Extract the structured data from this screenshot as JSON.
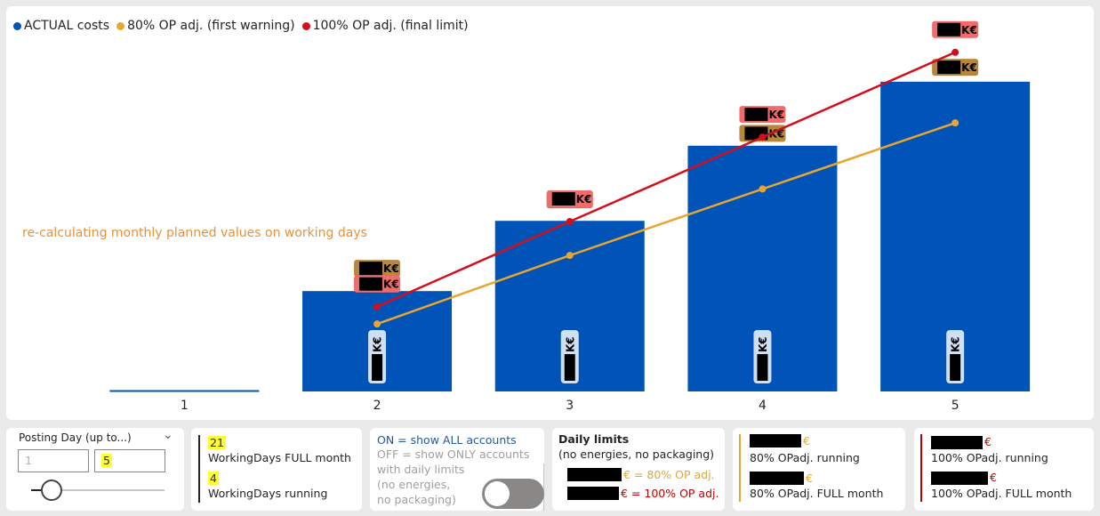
{
  "legend": [
    {
      "label": "ACTUAL costs",
      "color": "#0054b7"
    },
    {
      "label": "80% OP adj. (first warning)",
      "color": "#e8a530"
    },
    {
      "label": "100% OP adj. (final limit)",
      "color": "#d40f1b"
    }
  ],
  "annotation": "re-calculating monthly planned values on working days",
  "chart_data": {
    "type": "bar",
    "categories": [
      "1",
      "2",
      "3",
      "4",
      "5"
    ],
    "series": [
      {
        "name": "ACTUAL costs",
        "type": "bar",
        "values": [
          0,
          0.29,
          0.493,
          0.71,
          0.895
        ],
        "color": "#0054b7",
        "data_label": "K€"
      },
      {
        "name": "80% OP adj. (first warning)",
        "type": "line",
        "values": [
          null,
          0.195,
          0.393,
          0.585,
          0.776
        ],
        "color": "#e8a530",
        "data_label": "K€"
      },
      {
        "name": "100% OP adj. (final limit)",
        "type": "line",
        "values": [
          null,
          0.245,
          0.491,
          0.735,
          0.98
        ],
        "color": "#d40f1b",
        "data_label": "K€"
      }
    ],
    "ylim": [
      0,
      1
    ],
    "grid": false,
    "legend_position": "top-left"
  },
  "slicer": {
    "title": "Posting Day (up to...)",
    "min_value": "1",
    "max_value": "5",
    "slider_fraction": 0.15
  },
  "working_days": {
    "full_value": "21",
    "full_label": "WorkingDays FULL month",
    "running_value": "4",
    "running_label": "WorkingDays running"
  },
  "toggle": {
    "on_text": "ON = show ALL accounts",
    "off_lines": [
      "OFF = show ONLY accounts",
      "with daily limits",
      "(no energies,",
      "no packaging)"
    ],
    "state": "off"
  },
  "daily_limits": {
    "title": "Daily limits",
    "subtitle": "(no energies, no packaging)",
    "line80": "€ = 80% OP adj.",
    "line100": "€ = 100% OP adj.",
    "color80": "#e8a530",
    "color100": "#c00000"
  },
  "op80": {
    "unit": "€",
    "running_label": "80% OPadj. running",
    "full_label": "80% OPadj. FULL month",
    "color": "#e8a530"
  },
  "op100": {
    "unit": "€",
    "running_label": "100% OPadj. running",
    "full_label": "100% OPadj. FULL month",
    "color": "#c00000"
  }
}
